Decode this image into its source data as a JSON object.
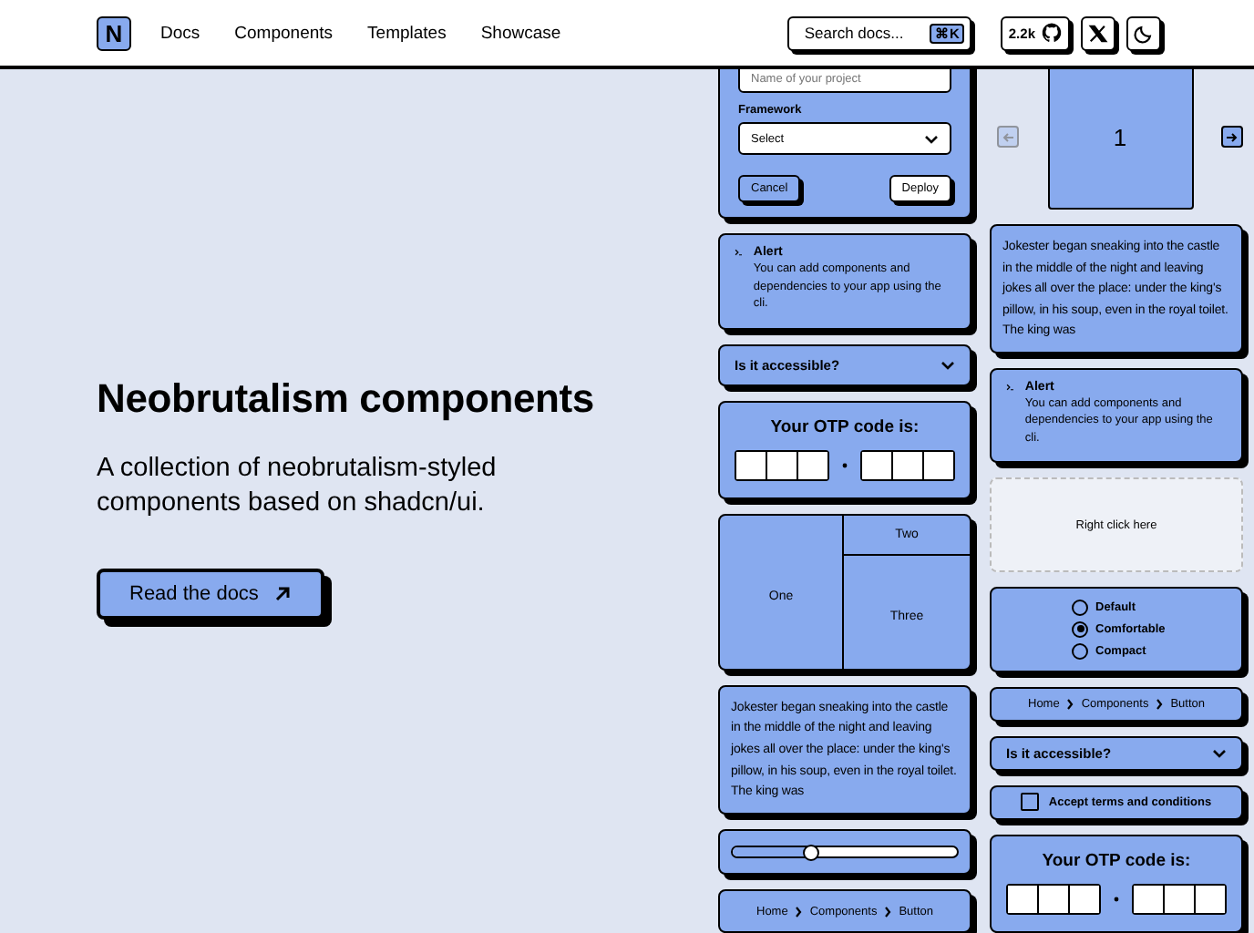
{
  "header": {
    "logo": "N",
    "nav": [
      {
        "label": "Docs"
      },
      {
        "label": "Components"
      },
      {
        "label": "Templates"
      },
      {
        "label": "Showcase"
      }
    ],
    "search": {
      "placeholder": "Search docs...",
      "shortcut": "⌘K"
    },
    "stars": "2.2k"
  },
  "hero": {
    "title": "Neobrutalism components",
    "subtitle": "A collection of neobrutalism-styled components based on shadcn/ui.",
    "button": "Read the docs"
  },
  "columns": [
    {
      "widgets": [
        {
          "kind": "form",
          "input_placeholder": "Name of your project",
          "select_label": "Framework",
          "select_placeholder": "Select",
          "cancel": "Cancel",
          "submit": "Deploy"
        },
        {
          "kind": "alert",
          "title": "Alert",
          "text": "You can add components and dependencies to your app using the cli."
        },
        {
          "kind": "accordion",
          "question": "Is it accessible?",
          "expanded": false
        },
        {
          "kind": "otp",
          "title": "Your OTP code is:"
        },
        {
          "kind": "resizable",
          "panels": [
            "One",
            "Two",
            "Three"
          ]
        },
        {
          "kind": "scroll",
          "text": "Jokester began sneaking into the castle in the middle of the night and leaving jokes all over the place: under the king's pillow, in his soup, even in the royal toilet. The king was"
        },
        {
          "kind": "slider",
          "level": 0.35
        },
        {
          "kind": "breadcrumb",
          "items": [
            "Home",
            "Components",
            "Button"
          ]
        }
      ]
    },
    {
      "widgets": [
        {
          "kind": "carousel",
          "slide": "1",
          "prev_disabled": true,
          "next_disabled": false
        },
        {
          "kind": "scroll",
          "text": "Jokester began sneaking into the castle in the middle of the night and leaving jokes all over the place: under the king's pillow, in his soup, even in the royal toilet. The king was"
        },
        {
          "kind": "alert",
          "title": "Alert",
          "text": "You can add components and dependencies to your app using the cli."
        },
        {
          "kind": "context",
          "text": "Right click here"
        },
        {
          "kind": "radio",
          "options": [
            {
              "label": "Default",
              "selected": false
            },
            {
              "label": "Comfortable",
              "selected": true
            },
            {
              "label": "Compact",
              "selected": false
            }
          ]
        },
        {
          "kind": "breadcrumb",
          "items": [
            "Home",
            "Components",
            "Button"
          ]
        },
        {
          "kind": "accordion",
          "question": "Is it accessible?",
          "expanded": false
        },
        {
          "kind": "checkbox",
          "label": "Accept terms and conditions",
          "checked": false
        },
        {
          "kind": "otp",
          "title": "Your OTP code is:"
        }
      ]
    }
  ]
}
